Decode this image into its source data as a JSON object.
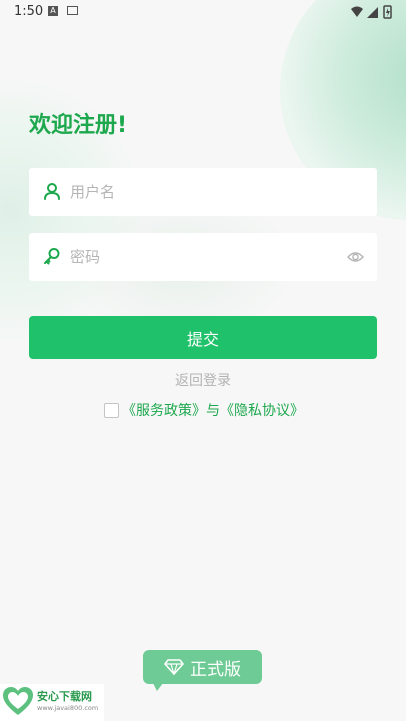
{
  "status_bar": {
    "time": "1:50",
    "icon_a": "A"
  },
  "form": {
    "title": "欢迎注册!",
    "username": {
      "placeholder": "用户名",
      "value": "",
      "icon": "user-icon"
    },
    "password": {
      "placeholder": "密码",
      "value": "",
      "icon": "key-icon",
      "toggle_icon": "eye-icon"
    },
    "submit_label": "提交",
    "back_login_label": "返回登录",
    "agreement": {
      "checked": false,
      "service_policy": "《服务政策》",
      "connector": "与",
      "privacy_policy": "《隐私协议》"
    }
  },
  "watermark": {
    "badge_label": "正式版",
    "site_name": "安心下载网",
    "site_url": "www.javai800.com"
  },
  "colors": {
    "accent": "#1fc26a",
    "title_green": "#1ea84e",
    "placeholder": "#b5b5b5",
    "background": "#f7f7f7"
  }
}
